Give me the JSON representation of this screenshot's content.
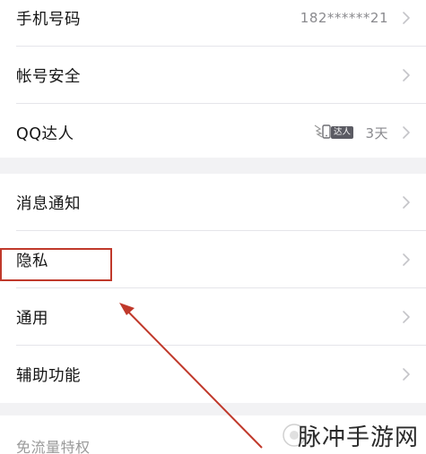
{
  "settings": {
    "group1": [
      {
        "label": "手机号码",
        "value": "182******21"
      },
      {
        "label": "帐号安全",
        "value": ""
      },
      {
        "label": "QQ达人",
        "badge_text": "达人",
        "value": "3天"
      }
    ],
    "group2": [
      {
        "label": "消息通知"
      },
      {
        "label": "隐私"
      },
      {
        "label": "通用"
      },
      {
        "label": "辅助功能"
      }
    ],
    "group3": [
      {
        "label": "免流量特权"
      }
    ]
  },
  "annotation": {
    "highlight_color": "#c0392b",
    "arrow_color": "#c0392b"
  },
  "watermark": {
    "text": "脉冲手游网"
  },
  "colors": {
    "background": "#f2f2f4",
    "row_bg": "#ffffff",
    "secondary_text": "#8a8a8e",
    "chevron": "#c4c4c8"
  }
}
